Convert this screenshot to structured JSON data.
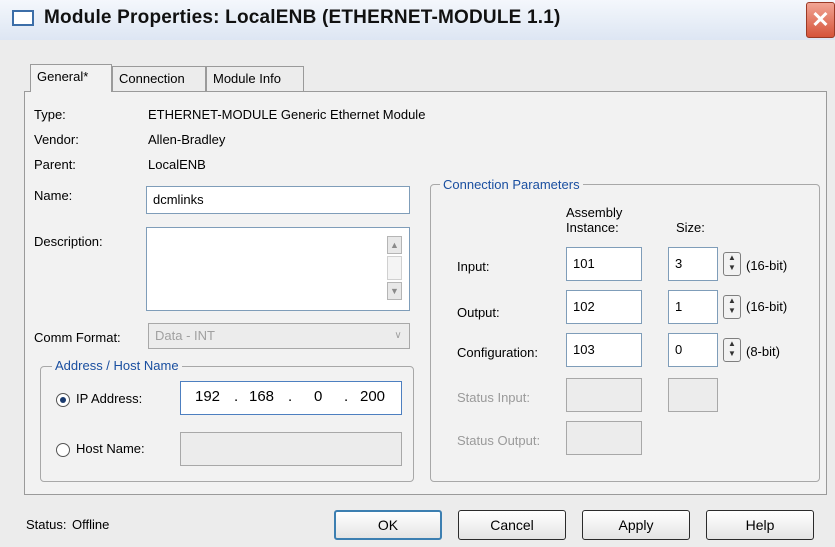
{
  "window": {
    "title": "Module Properties: LocalENB (ETHERNET-MODULE 1.1)",
    "close_glyph": "✕"
  },
  "tabs": [
    {
      "label": "General*"
    },
    {
      "label": "Connection"
    },
    {
      "label": "Module Info"
    }
  ],
  "general": {
    "type_label": "Type:",
    "type_value": "ETHERNET-MODULE Generic Ethernet Module",
    "vendor_label": "Vendor:",
    "vendor_value": "Allen-Bradley",
    "parent_label": "Parent:",
    "parent_value": "LocalENB",
    "name_label": "Name:",
    "name_value": "dcmlinks",
    "description_label": "Description:",
    "description_value": "",
    "comm_format_label": "Comm Format:",
    "comm_format_value": "Data - INT"
  },
  "address": {
    "group_title": "Address / Host Name",
    "ip_label": "IP Address:",
    "ip_octets": [
      "192",
      "168",
      "0",
      "200"
    ],
    "host_label": "Host Name:",
    "host_value": "",
    "selected": "ip"
  },
  "connection_params": {
    "group_title": "Connection Parameters",
    "col_instance": "Assembly\nInstance:",
    "col_size": "Size:",
    "rows": [
      {
        "label": "Input:",
        "instance": "101",
        "size": "3",
        "unit": "(16-bit)"
      },
      {
        "label": "Output:",
        "instance": "102",
        "size": "1",
        "unit": "(16-bit)"
      },
      {
        "label": "Configuration:",
        "instance": "103",
        "size": "0",
        "unit": "(8-bit)"
      },
      {
        "label": "Status Input:",
        "instance": "",
        "size": ""
      },
      {
        "label": "Status Output:",
        "instance": ""
      }
    ]
  },
  "footer": {
    "status_label": "Status:",
    "status_value": "Offline",
    "ok_label": "OK",
    "cancel_label": "Cancel",
    "apply_label": "Apply",
    "help_label": "Help"
  },
  "colors": {
    "group_title": "#1a4fa0",
    "close_button": "#d6543a",
    "default_button_border": "#3c7fb1"
  }
}
